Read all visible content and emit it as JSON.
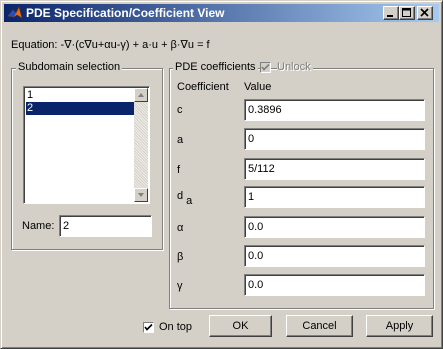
{
  "window": {
    "title": "PDE Specification/Coefficient View"
  },
  "equation": "Equation: -∇·(c∇u+αu-γ) + a·u + β·∇u = f",
  "subdomain": {
    "group_title": "Subdomain selection",
    "items": [
      "1",
      "2"
    ],
    "selected_index": 1,
    "name_label": "Name:",
    "name_value": "2"
  },
  "coefficients": {
    "group_title": "PDE coefficients",
    "unlock_label": "Unlock",
    "unlock_checked": true,
    "unlock_enabled": false,
    "col_coefficient": "Coefficient",
    "col_value": "Value",
    "rows": [
      {
        "name": "c",
        "value": "0.3896"
      },
      {
        "name": "a",
        "value": "0"
      },
      {
        "name": "f",
        "value": "5/112"
      },
      {
        "name": "d",
        "subscript": "a",
        "value": "1"
      },
      {
        "name": "α",
        "value": "0.0"
      },
      {
        "name": "β",
        "value": "0.0"
      },
      {
        "name": "γ",
        "value": "0.0"
      }
    ]
  },
  "footer": {
    "on_top_label": "On top",
    "on_top_checked": true,
    "ok_label": "OK",
    "cancel_label": "Cancel",
    "apply_label": "Apply"
  },
  "icons": {
    "title": "matlab-icon",
    "minimize": "minimize-icon",
    "maximize": "maximize-icon",
    "close": "close-icon",
    "scroll_up": "scroll-up-arrow-icon",
    "scroll_down": "scroll-down-arrow-icon",
    "check": "checkmark-icon"
  },
  "colors": {
    "title_bar_start": "#0a246a",
    "title_bar_end": "#a6caf0",
    "selection": "#0a246a",
    "face": "#d4d0c8"
  }
}
